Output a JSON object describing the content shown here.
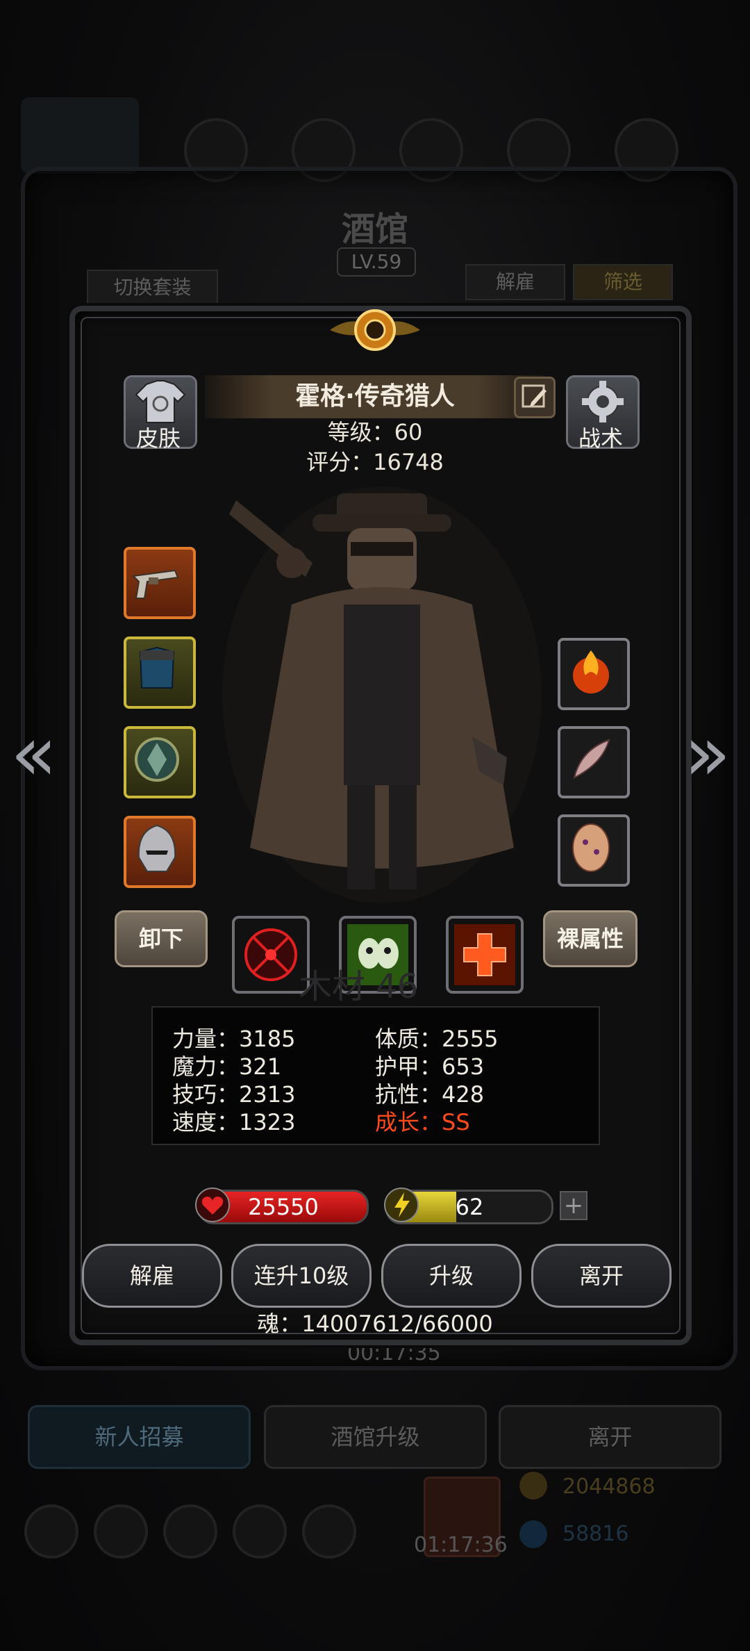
{
  "background": {
    "title": "酒馆",
    "level": "LV.59",
    "switch_outfit": "切换套装",
    "dismiss": "解雇",
    "filter": "筛选",
    "timer_top": "00:17:35",
    "recruit": "新人招募",
    "upgrade_tavern": "酒馆升级",
    "leave": "离开",
    "gold": "2044868",
    "gems": "58816",
    "timer_bottom": "01:17:36"
  },
  "hero": {
    "name": "霍格·传奇猎人",
    "level_text": "等级：60",
    "score_text": "评分：16748",
    "watermark": "木材 46"
  },
  "side_buttons": {
    "skin": "皮肤",
    "tactics": "战术"
  },
  "equipment_left": [
    {
      "icon": "revolver-icon",
      "quality": "orange"
    },
    {
      "icon": "armor-icon",
      "quality": "yellow"
    },
    {
      "icon": "amulet-icon",
      "quality": "yellow"
    },
    {
      "icon": "helmet-icon",
      "quality": "orange"
    }
  ],
  "equipment_right": [
    {
      "icon": "fire-orb-icon"
    },
    {
      "icon": "feather-icon"
    },
    {
      "icon": "rune-stone-icon"
    }
  ],
  "actions": {
    "unequip": "卸下",
    "base_attrs": "裸属性"
  },
  "skills": [
    "crosshair-skill-icon",
    "skull-skill-icon",
    "heal-cross-skill-icon"
  ],
  "stats": {
    "strength": "力量：3185",
    "constitution": "体质：2555",
    "magic": "魔力：321",
    "armor": "护甲：653",
    "skill": "技巧：2313",
    "resistance": "抗性：428",
    "speed": "速度：1323",
    "growth": "成长：SS"
  },
  "bars": {
    "hp": "25550",
    "energy": "62",
    "energy_fraction": 0.42,
    "plus": "+"
  },
  "buttons": {
    "dismiss": "解雇",
    "upgrade10": "连升10级",
    "upgrade": "升级",
    "leave": "离开"
  },
  "soul": "魂：14007612/66000",
  "colors": {
    "growth": "#ff4a1a",
    "hp": "#d21a1a",
    "energy": "#d6c22a"
  }
}
